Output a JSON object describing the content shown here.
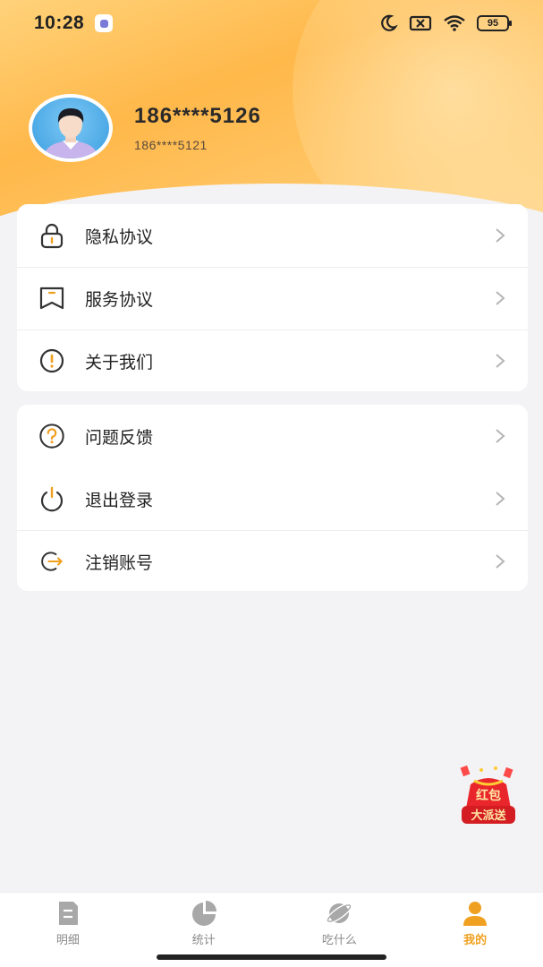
{
  "status_bar": {
    "time": "10:28",
    "battery": "95"
  },
  "profile": {
    "phone_main": "186****5126",
    "phone_sub": "186****5121"
  },
  "menu_group_1": [
    {
      "label": "隐私协议",
      "icon": "lock-icon"
    },
    {
      "label": "服务协议",
      "icon": "agreement-icon"
    },
    {
      "label": "关于我们",
      "icon": "info-icon"
    }
  ],
  "menu_group_2": [
    {
      "label": "问题反馈",
      "icon": "question-icon"
    },
    {
      "label": "退出登录",
      "icon": "power-icon"
    },
    {
      "label": "注销账号",
      "icon": "logout-icon"
    }
  ],
  "red_packet": {
    "line1": "红包",
    "line2": "大派送"
  },
  "tabs": [
    {
      "label": "明细",
      "icon": "document-icon"
    },
    {
      "label": "统计",
      "icon": "pie-chart-icon"
    },
    {
      "label": "吃什么",
      "icon": "planet-icon"
    },
    {
      "label": "我的",
      "icon": "user-icon"
    }
  ],
  "colors": {
    "accent": "#f0a020",
    "header_gradient_start": "#ffd27a",
    "header_gradient_end": "#ffb84a",
    "background": "#f3f3f5"
  }
}
